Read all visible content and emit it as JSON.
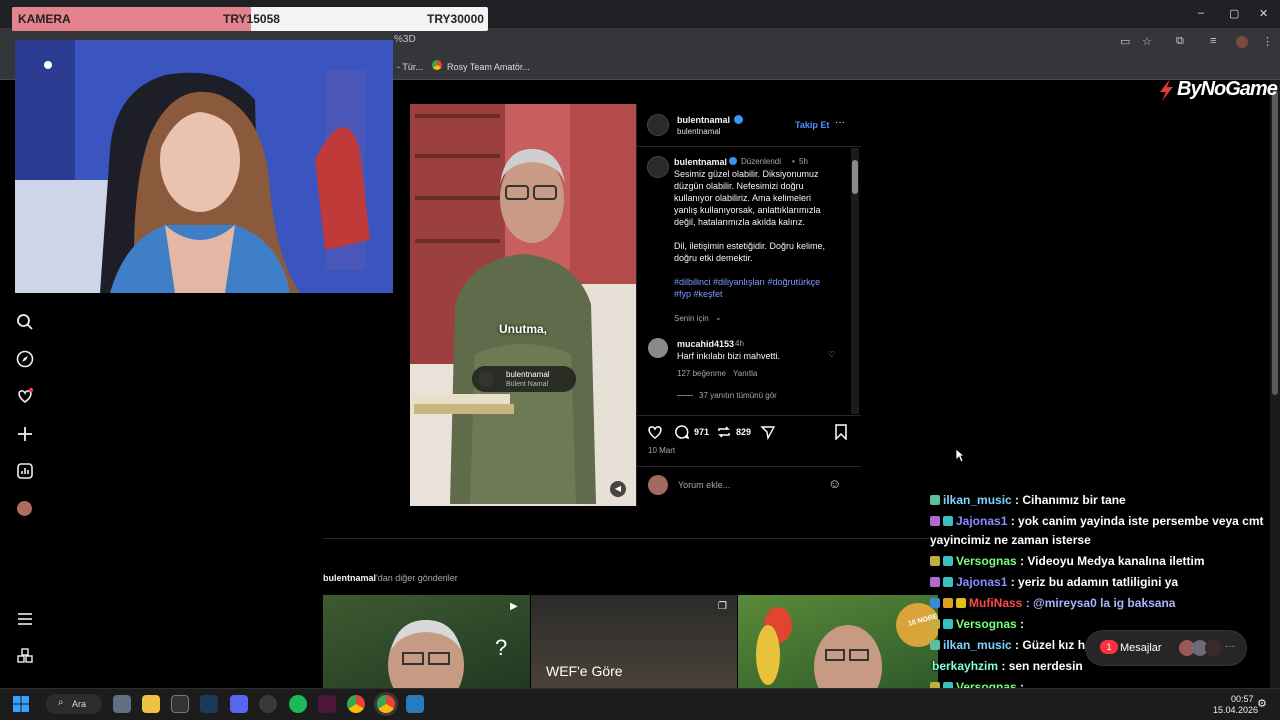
{
  "browser": {
    "url_tail": "%3D",
    "bookmarks": [
      {
        "label": "- Tür..."
      },
      {
        "label": "Rosy Team Amatör..."
      }
    ],
    "window_controls": {
      "minimize": "–",
      "maximize": "▢",
      "close": "✕"
    }
  },
  "overlay": {
    "donation_label": "KAMERA",
    "donation_current": "TRY15058",
    "donation_goal": "TRY30000",
    "donation_progress": 0.502,
    "brand": "ByNoGame"
  },
  "post": {
    "header_username": "bulentnamal",
    "header_subname": "bulentnamal",
    "follow_label": "Takip Et",
    "more_label": "···",
    "author": "bulentnamal",
    "edited": "Düzenlendi",
    "age": "5h",
    "caption_lines": [
      "Sesimiz güzel olabilir. Diksiyonumuz",
      "düzgün olabilir. Nefesimizi doğru",
      "kullanıyor olabiliriz. Ama kelimeleri",
      "yanlış kullanıyorsak, anlattıklarımızla",
      "değil, hatalarımızla akılda kalırız."
    ],
    "caption_lines2": [
      "Dil, iletişimin estetiğidir. Doğru kelime,",
      "doğru etki demektir."
    ],
    "hashtags_line1": "#dilbilinci #diliyanlışları #doğrutürkçe",
    "hashtags_line2": "#fyp #keşfet",
    "for_you": "Senin için",
    "comment": {
      "user": "mucahid4153",
      "age": "4h",
      "text": "Harf inkılabı bizi mahvetti.",
      "likes": "127 beğenme",
      "reply": "Yanıtla",
      "view_replies": "37 yanıtın tümünü gör"
    },
    "likes_count": "971",
    "reposts_count": "829",
    "date": "10 Mart",
    "comment_placeholder": "Yorum ekle...",
    "video_subtitle": "Unutma,",
    "video_tag_user": "bulentnamal",
    "video_tag_name": "Bülent Namal"
  },
  "more_posts": {
    "label_user": "bulentnamal",
    "label_rest": "'dan diğer gönderiler",
    "thumb2_text": "WEF'e Göre",
    "thumb3_badge": "10 NOBE"
  },
  "chat": [
    {
      "user": "ilkan_music",
      "color": "#7fd3ff",
      "text": ": Cihanımız bir tane"
    },
    {
      "user": "Jajonas1",
      "color": "#8a8cff",
      "text": ": yok canim yayinda iste persembe veya cmt"
    },
    {
      "user": "",
      "color": "#ffffff",
      "text": "yayincimiz ne zaman isterse"
    },
    {
      "user": "Versognas",
      "color": "#7bff7b",
      "text": ": Videoyu Medya kanalına ilettim"
    },
    {
      "user": "Jajonas1",
      "color": "#8a8cff",
      "text": ": yeriz bu adamın tatliligini ya"
    },
    {
      "user": "MufiNass",
      "color": "#ff4a4a",
      "text": ": @mireysa0 la ig baksana"
    },
    {
      "user": "Versognas",
      "color": "#7bff7b",
      "text": ":"
    },
    {
      "user": "ilkan_music",
      "color": "#7fd3ff",
      "text": ": Güzel kız harbiden"
    },
    {
      "user": "berkayhzim",
      "color": "#8affd8",
      "text": ": sen nerdesin"
    },
    {
      "user": "Versognas",
      "color": "#7bff7b",
      "text": ":"
    }
  ],
  "messages_pill": {
    "label": "Mesajlar",
    "badge": "1"
  },
  "taskbar": {
    "search_label": "Ara",
    "time": "00:57",
    "date": "15.04.2026"
  }
}
